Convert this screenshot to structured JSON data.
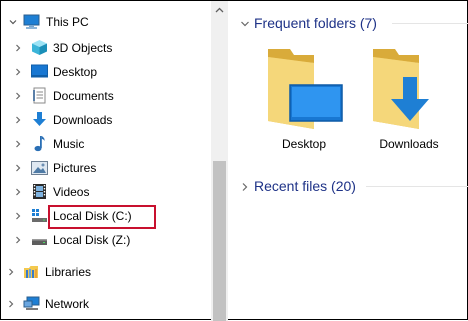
{
  "nav": {
    "this_pc": "This PC",
    "items": [
      {
        "label": "3D Objects",
        "icon": "cube-3d-icon"
      },
      {
        "label": "Desktop",
        "icon": "desktop-icon"
      },
      {
        "label": "Documents",
        "icon": "documents-icon"
      },
      {
        "label": "Downloads",
        "icon": "download-arrow-icon"
      },
      {
        "label": "Music",
        "icon": "music-note-icon"
      },
      {
        "label": "Pictures",
        "icon": "pictures-icon"
      },
      {
        "label": "Videos",
        "icon": "film-icon"
      },
      {
        "label": "Local Disk (C:)",
        "icon": "windows-drive-icon",
        "highlighted": true
      },
      {
        "label": "Local Disk (Z:)",
        "icon": "drive-icon"
      }
    ],
    "libraries": "Libraries",
    "network": "Network",
    "highlight_color": "#c8102e"
  },
  "content": {
    "frequent_header": "Frequent folders (7)",
    "frequent_tiles": [
      {
        "label": "Desktop",
        "icon": "desktop-folder-icon"
      },
      {
        "label": "Downloads",
        "icon": "downloads-folder-icon"
      }
    ],
    "recent_header": "Recent files (20)",
    "header_color": "#1e3287"
  }
}
